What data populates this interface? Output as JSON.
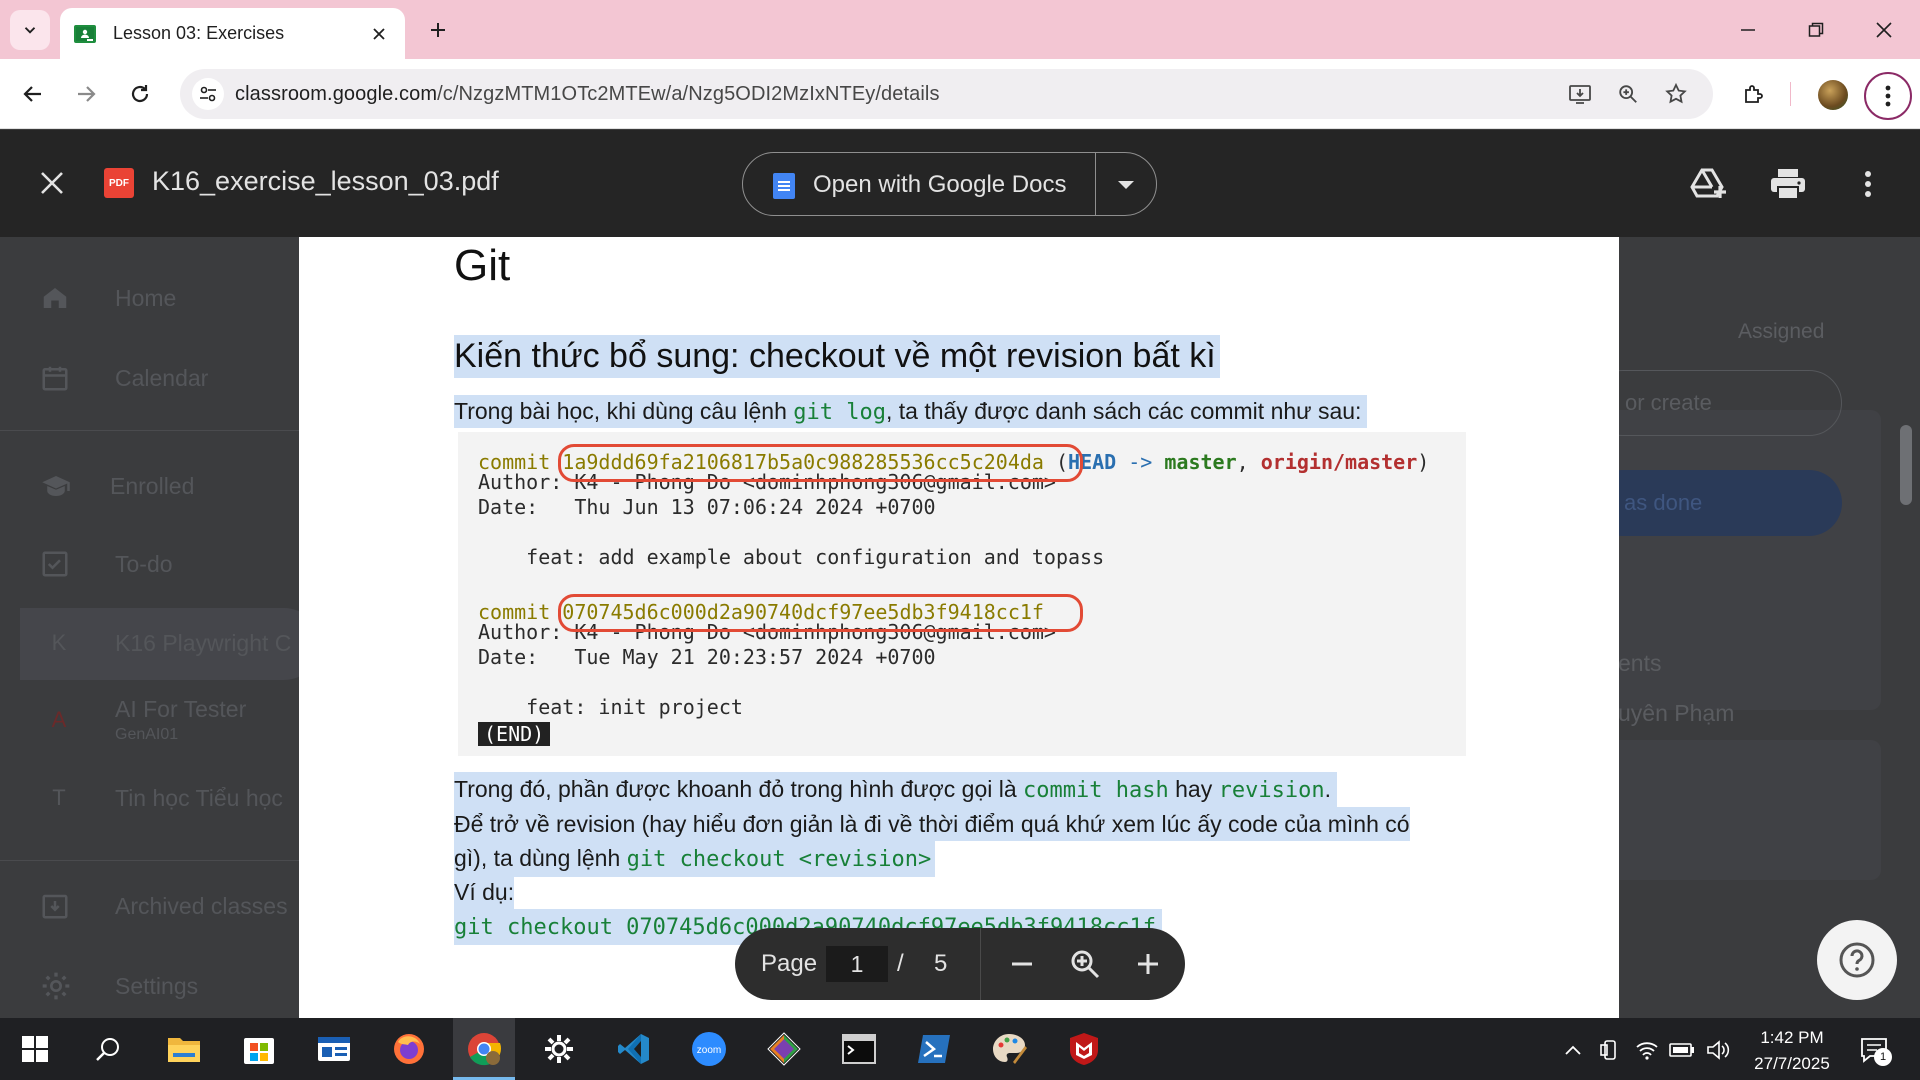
{
  "browser": {
    "tab_title": "Lesson 03: Exercises",
    "url_domain": "classroom.google.com",
    "url_path": "/c/NzgzMTM1OTc2MTEw/a/Nzg5ODI2MzIxNTEy/details"
  },
  "classroom_background": {
    "sidebar": [
      {
        "label": "Home",
        "icon": "home-icon"
      },
      {
        "label": "Calendar",
        "icon": "calendar-icon"
      },
      {
        "label": "Enrolled",
        "icon": "enrolled-icon"
      },
      {
        "label": "To-do",
        "icon": "todo-icon"
      },
      {
        "label": "K16 Playwright C",
        "letter": "K"
      },
      {
        "label": "AI For Tester",
        "sub": "GenAI01",
        "letter": "A"
      },
      {
        "label": "Tin học Tiểu học",
        "letter": "T"
      },
      {
        "label": "Archived classes",
        "icon": "archive-icon"
      },
      {
        "label": "Settings",
        "icon": "settings-icon"
      }
    ],
    "right_panel": {
      "assigned": "Assigned",
      "add_or_create": "or create",
      "mark_as_done": "as done",
      "comments": "ents",
      "person": "uyên Phạm"
    }
  },
  "pdf_viewer": {
    "file_name": "K16_exercise_lesson_03.pdf",
    "file_badge": "PDF",
    "open_with_label": "Open with Google Docs",
    "page_label": "Page",
    "current_page": "1",
    "page_separator": "/",
    "total_pages": "5"
  },
  "document": {
    "title_fragment": "Git",
    "section_heading": "Kiến thức bổ sung: checkout về một revision bất kì",
    "intro_before": "Trong bài học, khi dùng câu lệnh ",
    "intro_code": "git log",
    "intro_after": ", ta thấy được danh sách các commit như sau:",
    "git_log": {
      "commit_word": "commit",
      "hash1": "1a9ddd69fa2106817b5a0c988285536cc5c204da",
      "ref_open": "(",
      "ref_head": "HEAD",
      "ref_arrow": "->",
      "ref_master": "master",
      "ref_comma": ",",
      "ref_origin": "origin/master",
      "ref_close": ")",
      "author1": "Author: K4 - Phong Do <dominhphong306@gmail.com>",
      "date1": "Date:   Thu Jun 13 07:06:24 2024 +0700",
      "msg1": "    feat: add example about configuration and topass",
      "hash2": "070745d6c000d2a90740dcf97ee5db3f9418cc1f",
      "author2": "Author: K4 - Phong Do <dominhphong306@gmail.com>",
      "date2": "Date:   Tue May 21 20:23:57 2024 +0700",
      "msg2": "    feat: init project",
      "end": "(END)"
    },
    "p2_before": "Trong đó, phần được khoanh đỏ trong hình được gọi là ",
    "p2_code1": "commit hash",
    "p2_mid": " hay ",
    "p2_code2": "revision",
    "p2_end": ".",
    "p3": "Để trở về revision (hay hiểu đơn giản là đi về thời điểm quá khứ xem lúc ấy code của mình có",
    "p4_before": "gì), ta dùng lệnh ",
    "p4_code": "git checkout <revision>",
    "p5": "Ví dụ:",
    "p6_code": "git checkout 070745d6c000d2a90740dcf97ee5db3f9418cc1f"
  },
  "taskbar": {
    "apps": [
      "start-icon",
      "search-icon",
      "file-explorer-icon",
      "store-icon",
      "app-icon",
      "firefox-icon",
      "chrome-icon",
      "settings-icon",
      "vscode-icon",
      "zoom-icon",
      "git-icon",
      "terminal-icon",
      "powershell-icon",
      "paint-icon",
      "mcafee-icon"
    ],
    "time": "1:42 PM",
    "date": "27/7/2025",
    "notification_count": "1"
  },
  "colors": {
    "tab_bar": "#f3c6d3",
    "highlight": "#cfe0f5",
    "code_green": "#188038",
    "ring_red": "#e24a35"
  }
}
